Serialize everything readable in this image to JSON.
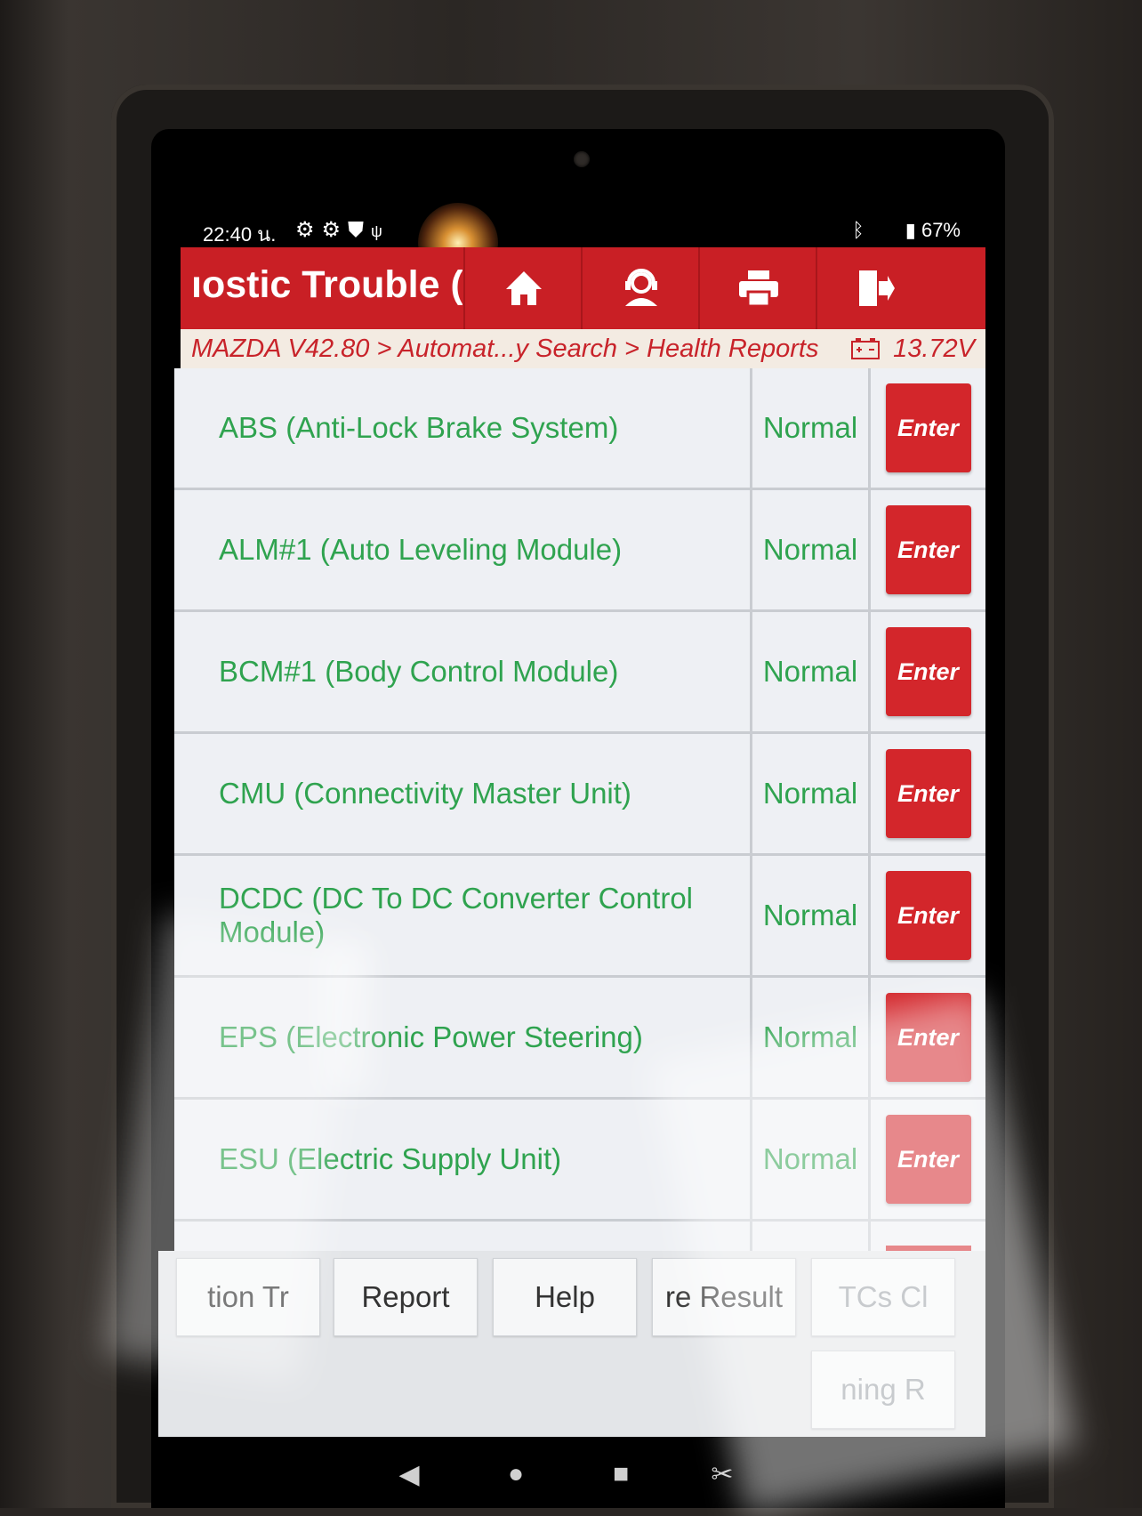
{
  "status_bar": {
    "time": "22:40 น.",
    "left_icons": [
      "gear-icon",
      "gear-icon",
      "shield-icon",
      "usb-icon"
    ],
    "right_icons": [
      "bluetooth-icon",
      "battery-icon"
    ],
    "battery": "67%"
  },
  "header": {
    "title": "ıostic Trouble (",
    "buttons": [
      "home-icon",
      "support-icon",
      "print-icon",
      "exit-icon"
    ]
  },
  "breadcrumb": {
    "path": "MAZDA V42.80 > Automat...y Search > Health Reports",
    "voltage": "13.72V"
  },
  "rows": [
    {
      "name": "ABS (Anti-Lock Brake System)",
      "status": "Normal",
      "action": "Enter"
    },
    {
      "name": "ALM#1 (Auto Leveling Module)",
      "status": "Normal",
      "action": "Enter"
    },
    {
      "name": "BCM#1 (Body Control Module)",
      "status": "Normal",
      "action": "Enter"
    },
    {
      "name": "CMU (Connectivity Master Unit)",
      "status": "Normal",
      "action": "Enter"
    },
    {
      "name": "DCDC (DC To DC Converter Control Module)",
      "status": "Normal",
      "action": "Enter"
    },
    {
      "name": "EPS (Electronic Power Steering)",
      "status": "Normal",
      "action": "Enter"
    },
    {
      "name": "ESU (Electric Supply Unit)",
      "status": "Normal",
      "action": "Enter"
    }
  ],
  "bottom_buttons": {
    "b1": "tion    Tr",
    "b2": "Report",
    "b3": "Help",
    "b4": "re Result",
    "b5": "TCs     Cl",
    "b6": "ning     R"
  },
  "colors": {
    "header_red": "#c91f25",
    "status_green": "#2fa34f",
    "breadcrumb_text": "#c8232a"
  }
}
